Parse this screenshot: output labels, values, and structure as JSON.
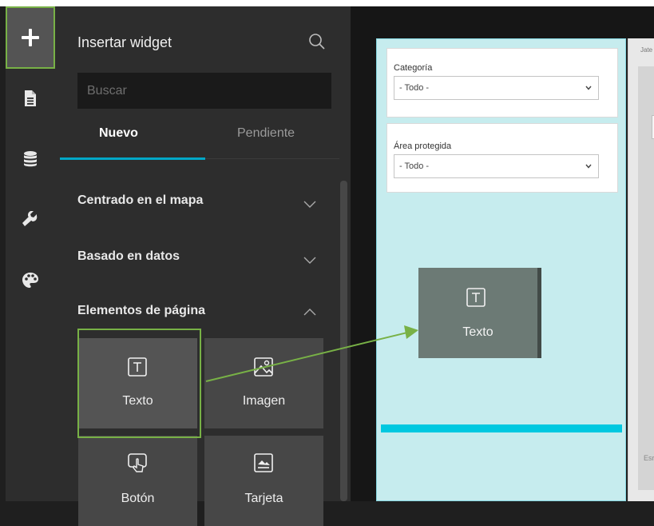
{
  "rail": {
    "items": [
      {
        "icon": "plus-icon"
      },
      {
        "icon": "page-icon"
      },
      {
        "icon": "database-icon"
      },
      {
        "icon": "wrench-icon"
      },
      {
        "icon": "palette-icon"
      }
    ]
  },
  "panel": {
    "title": "Insertar widget",
    "search_placeholder": "Buscar",
    "tabs": [
      {
        "label": "Nuevo",
        "active": true
      },
      {
        "label": "Pendiente",
        "active": false
      }
    ],
    "sections": [
      {
        "label": "Centrado en el mapa",
        "expanded": false
      },
      {
        "label": "Basado en datos",
        "expanded": false
      },
      {
        "label": "Elementos de página",
        "expanded": true
      }
    ],
    "widgets": [
      {
        "label": "Texto",
        "icon": "text-icon",
        "selected": true
      },
      {
        "label": "Imagen",
        "icon": "image-icon",
        "selected": false
      },
      {
        "label": "Botón",
        "icon": "button-icon",
        "selected": false
      },
      {
        "label": "Tarjeta",
        "icon": "card-icon",
        "selected": false
      }
    ]
  },
  "canvas": {
    "filters": [
      {
        "label": "Categoría",
        "value": "- Todo -"
      },
      {
        "label": "Área protegida",
        "value": "- Todo -"
      }
    ],
    "dropped_widget": {
      "label": "Texto",
      "icon": "text-icon"
    },
    "map_label_top": "Jate",
    "map_label_bottom": "Esri"
  },
  "colors": {
    "accent_green": "#78b146",
    "tab_underline": "#00a7c7",
    "page_background": "#c6ecee",
    "drop_bar": "#00c8e0"
  }
}
